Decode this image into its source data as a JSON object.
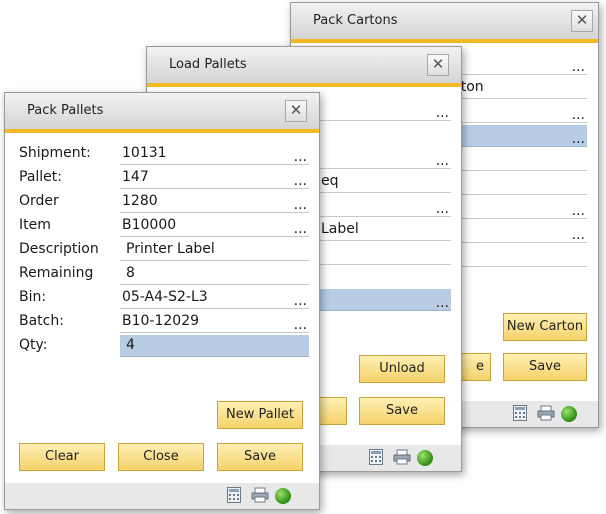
{
  "pack_cartons": {
    "title": "Pack Cartons",
    "close_label": "✕",
    "visible_values": [
      "rton"
    ],
    "new_carton_label": "New Carton",
    "save_label": "Save",
    "partial_button": "e"
  },
  "load_pallets": {
    "title": "Load Pallets",
    "close_label": "✕",
    "visible_values": [
      "eq",
      "Label"
    ],
    "unload_label": "Unload",
    "save_label": "Save"
  },
  "pack_pallets": {
    "title": "Pack Pallets",
    "close_label": "✕",
    "fields": [
      {
        "label": "Shipment:",
        "value": "10131",
        "lookup": "..."
      },
      {
        "label": "Pallet:",
        "value": "147",
        "lookup": "..."
      },
      {
        "label": "Order",
        "value": "1280",
        "lookup": "..."
      },
      {
        "label": "Item",
        "value": "B10000",
        "lookup": "..."
      },
      {
        "label": "Description",
        "value": "Printer Label",
        "lookup": ""
      },
      {
        "label": "Remaining",
        "value": "8",
        "lookup": ""
      },
      {
        "label": "Bin:",
        "value": "05-A4-S2-L3",
        "lookup": "..."
      },
      {
        "label": "Batch:",
        "value": "B10-12029",
        "lookup": "..."
      },
      {
        "label": "Qty:",
        "value": "4",
        "lookup": ""
      }
    ],
    "new_pallet_label": "New Pallet",
    "clear_label": "Clear",
    "close_button_label": "Close",
    "save_label": "Save"
  },
  "status_icons": [
    "calculator-icon",
    "printer-icon",
    "green-status-icon"
  ]
}
